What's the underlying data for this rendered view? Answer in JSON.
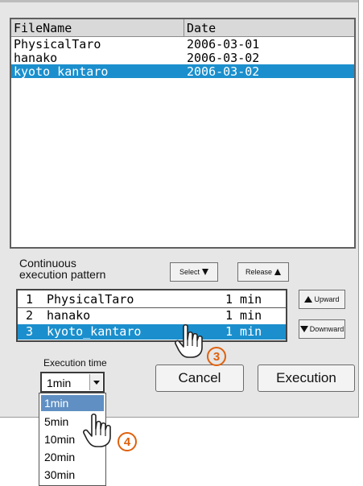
{
  "file_table": {
    "headers": [
      "FileName",
      "Date"
    ],
    "rows": [
      {
        "name": "PhysicalTaro",
        "date": "2006-03-01"
      },
      {
        "name": "hanako",
        "date": "2006-03-02"
      },
      {
        "name": "kyoto_kantaro",
        "date": "2006-03-02"
      }
    ]
  },
  "pattern": {
    "label_line1": "Continuous",
    "label_line2": "execution pattern",
    "select_label": "Select",
    "release_label": "Release",
    "upward_label": "Upward",
    "downward_label": "Downward",
    "rows": [
      {
        "num": "1",
        "name": "PhysicalTaro",
        "time": "1 min"
      },
      {
        "num": "2",
        "name": "hanako",
        "time": "1 min"
      },
      {
        "num": "3",
        "name": "kyoto_kantaro",
        "time": "1 min"
      }
    ]
  },
  "execution_time": {
    "label": "Execution time",
    "selected": "1min",
    "options": [
      "1min",
      "5min",
      "10min",
      "20min",
      "30min"
    ]
  },
  "buttons": {
    "cancel": "Cancel",
    "execution": "Execution"
  },
  "callouts": {
    "step3": "3",
    "step4": "4"
  },
  "colors": {
    "selection_blue": "#1b8fcd",
    "dropdown_highlight": "#5f8fc3",
    "callout_orange": "#e0600c"
  }
}
